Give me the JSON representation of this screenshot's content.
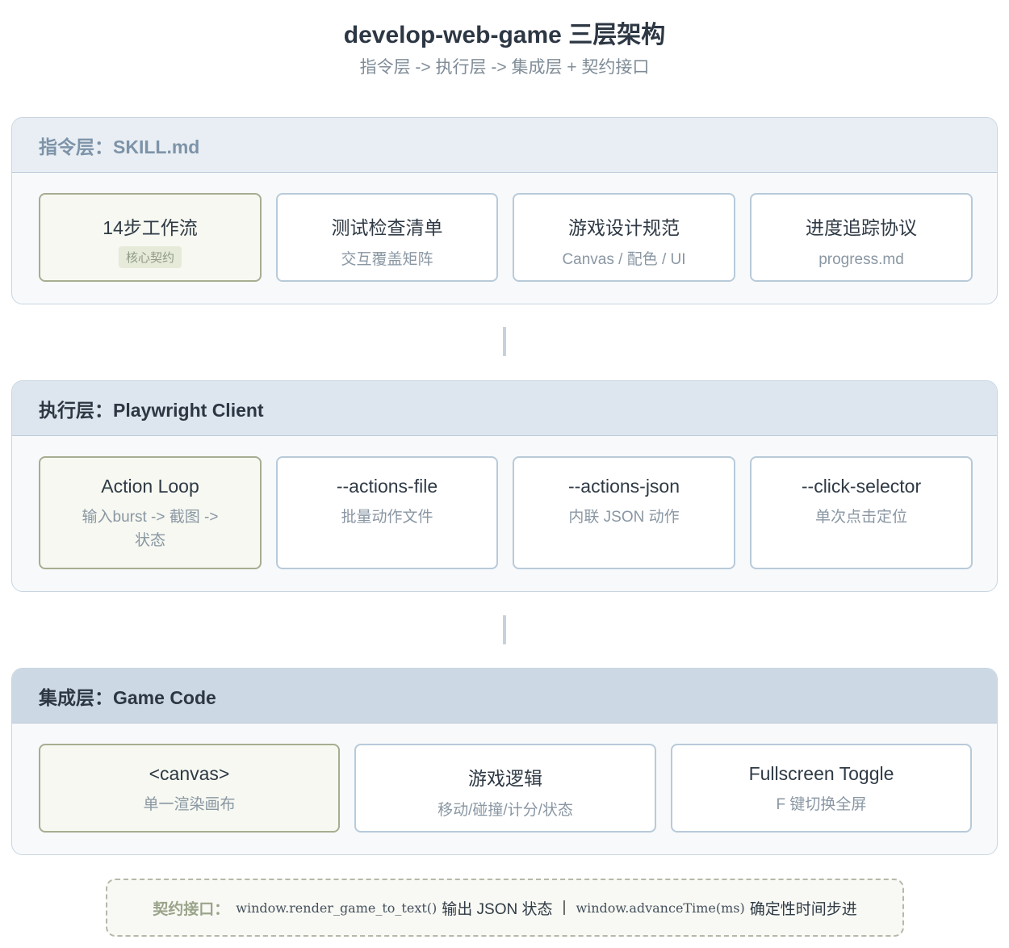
{
  "header": {
    "title": "develop-web-game 三层架构",
    "subtitle": "指令层 -> 执行层 -> 集成层 + 契约接口"
  },
  "layers": [
    {
      "title": "指令层：SKILL.md",
      "cards": [
        {
          "title": "14步工作流",
          "badge": "核心契约"
        },
        {
          "title": "测试检查清单",
          "sub": "交互覆盖矩阵"
        },
        {
          "title": "游戏设计规范",
          "sub": "Canvas / 配色 / UI"
        },
        {
          "title": "进度追踪协议",
          "sub": "progress.md"
        }
      ]
    },
    {
      "title": "执行层：Playwright Client",
      "cards": [
        {
          "title": "Action Loop",
          "sub": "输入burst -> 截图 ->",
          "sub2": "状态"
        },
        {
          "title": "--actions-file",
          "sub": "批量动作文件"
        },
        {
          "title": "--actions-json",
          "sub": "内联 JSON 动作"
        },
        {
          "title": "--click-selector",
          "sub": "单次点击定位"
        }
      ]
    },
    {
      "title": "集成层：Game Code",
      "cards": [
        {
          "title": "<canvas>",
          "sub": "单一渲染画布"
        },
        {
          "title": "游戏逻辑",
          "sub": "移动/碰撞/计分/状态"
        },
        {
          "title": "Fullscreen Toggle",
          "sub": "F 键切换全屏"
        }
      ]
    }
  ],
  "contract": {
    "label": "契约接口：",
    "fn1": "window.render_game_to_text()",
    "fn1_desc": "输出 JSON 状态",
    "separator": "|",
    "fn2": "window.advanceTime(ms)",
    "fn2_desc": "确定性时间步进"
  }
}
